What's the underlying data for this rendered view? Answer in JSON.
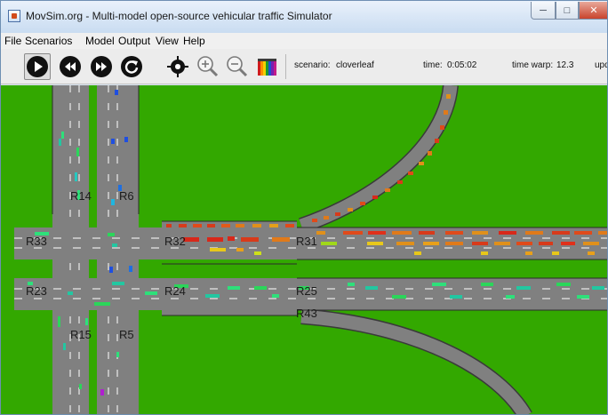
{
  "window": {
    "title": "MovSim.org - Multi-model open-source vehicular traffic Simulator",
    "min_glyph": "─",
    "max_glyph": "□",
    "close_glyph": "✕"
  },
  "menu": [
    "File",
    "Scenarios",
    "Model",
    "Output",
    "View",
    "Help"
  ],
  "toolbar": {
    "buttons": [
      {
        "name": "play-icon"
      },
      {
        "name": "rewind-icon"
      },
      {
        "name": "fast-forward-icon"
      },
      {
        "name": "restart-icon"
      },
      {
        "name": "center-target-icon"
      },
      {
        "name": "zoom-in-icon"
      },
      {
        "name": "zoom-out-icon"
      },
      {
        "name": "color-palette-icon"
      }
    ],
    "scenario_label": "scenario:",
    "scenario_value": "cloverleaf",
    "time_label": "time:",
    "time_value": "0:05:02",
    "warp_label": "time warp:",
    "warp_value": "12.3",
    "update_label": "upd"
  },
  "colors": {
    "grass": "#33a800",
    "road": "#808080",
    "lane_mark": "#ffffff"
  },
  "roads": {
    "labels": [
      "R14",
      "R6",
      "R33",
      "R32",
      "R31",
      "R23",
      "R24",
      "R25",
      "R43",
      "R15",
      "R5"
    ]
  }
}
